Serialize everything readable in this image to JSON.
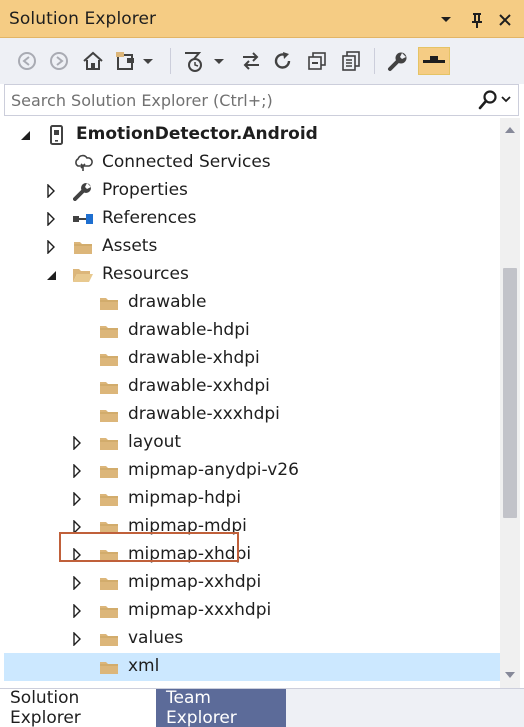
{
  "window": {
    "title": "Solution Explorer",
    "dropdown_icon": "chevron-down-icon",
    "pin_icon": "pin-icon",
    "close_icon": "close-icon"
  },
  "toolbar": {
    "buttons": [
      {
        "name": "back-icon"
      },
      {
        "name": "forward-icon"
      },
      {
        "name": "home-icon"
      },
      {
        "name": "switch-views-icon"
      },
      {
        "name": "pending-changes-filter-icon"
      },
      {
        "name": "sync-with-active-document-icon"
      },
      {
        "name": "refresh-icon"
      },
      {
        "name": "collapse-all-icon"
      },
      {
        "name": "show-all-files-icon"
      },
      {
        "name": "properties-wrench-icon"
      },
      {
        "name": "preview-selected-items-icon"
      }
    ]
  },
  "search": {
    "placeholder": "Search Solution Explorer (Ctrl+;)",
    "value": ""
  },
  "tree": {
    "items": [
      {
        "label": "EmotionDetector.Android",
        "expander": "expanded",
        "icon": "android-project-icon",
        "bold": true,
        "level": 0
      },
      {
        "label": "Connected Services",
        "expander": "none",
        "icon": "connected-services-icon",
        "bold": false,
        "level": 1
      },
      {
        "label": "Properties",
        "expander": "collapsed",
        "icon": "wrench-icon",
        "bold": false,
        "level": 1
      },
      {
        "label": "References",
        "expander": "collapsed",
        "icon": "references-icon",
        "bold": false,
        "level": 1
      },
      {
        "label": "Assets",
        "expander": "collapsed",
        "icon": "folder-icon",
        "bold": false,
        "level": 1
      },
      {
        "label": "Resources",
        "expander": "expanded",
        "icon": "folder-open-icon",
        "bold": false,
        "level": 1
      },
      {
        "label": "drawable",
        "expander": "none",
        "icon": "folder-icon",
        "bold": false,
        "level": 2
      },
      {
        "label": "drawable-hdpi",
        "expander": "none",
        "icon": "folder-icon",
        "bold": false,
        "level": 2
      },
      {
        "label": "drawable-xhdpi",
        "expander": "none",
        "icon": "folder-icon",
        "bold": false,
        "level": 2
      },
      {
        "label": "drawable-xxhdpi",
        "expander": "none",
        "icon": "folder-icon",
        "bold": false,
        "level": 2
      },
      {
        "label": "drawable-xxxhdpi",
        "expander": "none",
        "icon": "folder-icon",
        "bold": false,
        "level": 2
      },
      {
        "label": "layout",
        "expander": "collapsed",
        "icon": "folder-icon",
        "bold": false,
        "level": 2
      },
      {
        "label": "mipmap-anydpi-v26",
        "expander": "collapsed",
        "icon": "folder-icon",
        "bold": false,
        "level": 2
      },
      {
        "label": "mipmap-hdpi",
        "expander": "collapsed",
        "icon": "folder-icon",
        "bold": false,
        "level": 2
      },
      {
        "label": "mipmap-mdpi",
        "expander": "collapsed",
        "icon": "folder-icon",
        "bold": false,
        "level": 2
      },
      {
        "label": "mipmap-xhdpi",
        "expander": "collapsed",
        "icon": "folder-icon",
        "bold": false,
        "level": 2
      },
      {
        "label": "mipmap-xxhdpi",
        "expander": "collapsed",
        "icon": "folder-icon",
        "bold": false,
        "level": 2
      },
      {
        "label": "mipmap-xxxhdpi",
        "expander": "collapsed",
        "icon": "folder-icon",
        "bold": false,
        "level": 2
      },
      {
        "label": "values",
        "expander": "collapsed",
        "icon": "folder-icon",
        "bold": false,
        "level": 2
      },
      {
        "label": "xml",
        "expander": "none",
        "icon": "folder-icon",
        "bold": false,
        "level": 2,
        "selected": true
      }
    ]
  },
  "scrollbar": {
    "position": 0.55
  },
  "bottom_tabs": [
    {
      "label": "Solution Explorer",
      "active": true
    },
    {
      "label": "Team Explorer",
      "active": false
    }
  ],
  "colors": {
    "title_bar": "#f5cc84",
    "toolbar": "#eef0f5",
    "selection": "#cce8ff",
    "highlight_border": "#c0603a",
    "folder": "#dcb67a",
    "inactive_tab": "#5c6b99"
  }
}
